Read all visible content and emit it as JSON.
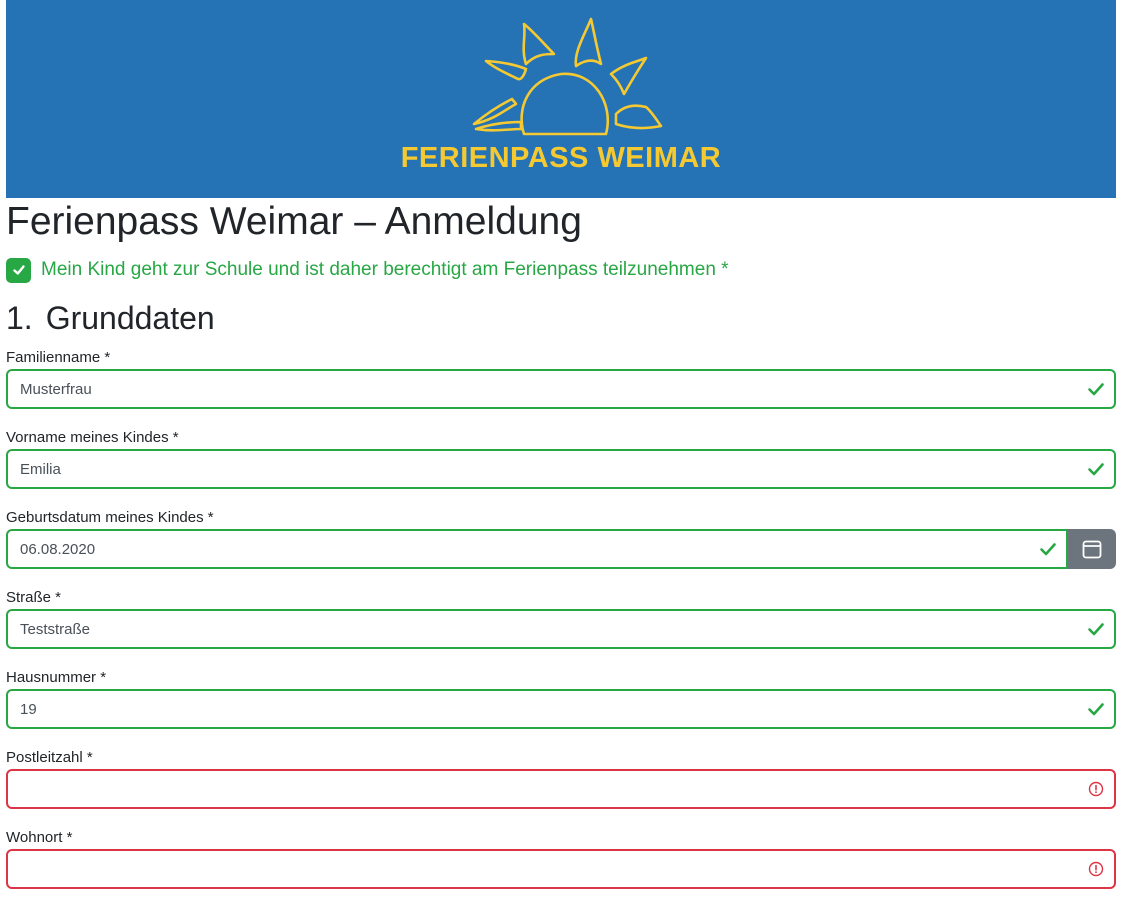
{
  "banner": {
    "brand": "FERIENPASS WEIMAR",
    "logo_icon": "sun-logo-icon",
    "background_color": "#2573b5",
    "accent_color": "#f5c931"
  },
  "title": "Ferienpass Weimar – Anmeldung",
  "eligibility": {
    "checked": true,
    "label": "Mein Kind geht zur Schule und ist daher berechtigt am Ferienpass teilzunehmen *"
  },
  "section": {
    "number": "1.",
    "title": "Grunddaten"
  },
  "fields": {
    "familienname": {
      "label": "Familienname *",
      "value": "Musterfrau",
      "state": "valid"
    },
    "vorname": {
      "label": "Vorname meines Kindes *",
      "value": "Emilia",
      "state": "valid"
    },
    "geburtsdatum": {
      "label": "Geburtsdatum meines Kindes *",
      "value": "06.08.2020",
      "state": "valid",
      "button_icon": "calendar-icon"
    },
    "strasse": {
      "label": "Straße *",
      "value": "Teststraße",
      "state": "valid"
    },
    "hausnummer": {
      "label": "Hausnummer *",
      "value": "19",
      "state": "valid"
    },
    "postleitzahl": {
      "label": "Postleitzahl *",
      "value": "",
      "state": "invalid"
    },
    "wohnort": {
      "label": "Wohnort *",
      "value": "",
      "state": "invalid"
    }
  },
  "colors": {
    "valid": "#28a745",
    "invalid": "#dc3545",
    "button": "#6c757d"
  }
}
